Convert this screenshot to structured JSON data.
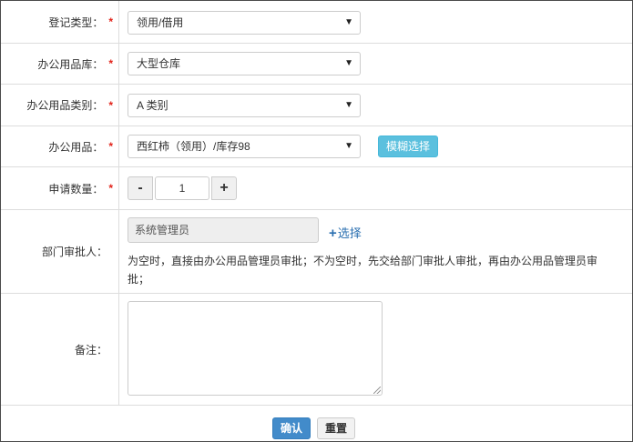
{
  "form": {
    "register_type": {
      "label": "登记类型：",
      "required_mark": "*",
      "value": "领用/借用"
    },
    "warehouse": {
      "label": "办公用品库：",
      "required_mark": "*",
      "value": "大型仓库"
    },
    "category": {
      "label": "办公用品类别：",
      "required_mark": "*",
      "value": "A 类别"
    },
    "item": {
      "label": "办公用品：",
      "required_mark": "*",
      "value": "西红柿（领用）/库存98",
      "fuzzy_button": "模糊选择"
    },
    "quantity": {
      "label": "申请数量：",
      "required_mark": "*",
      "value": "1",
      "minus": "-",
      "plus": "+"
    },
    "approver": {
      "label": "部门审批人：",
      "value": "系统管理员",
      "select_icon": "+",
      "select_link": "选择",
      "hint": "为空时，直接由办公用品管理员审批；不为空时，先交给部门审批人审批，再由办公用品管理员审批；"
    },
    "remark": {
      "label": "备注：",
      "value": ""
    }
  },
  "actions": {
    "confirm": "确认",
    "reset": "重置"
  },
  "icons": {
    "dropdown": "dropdown-caret-icon",
    "plus": "plus-icon"
  },
  "colors": {
    "required": "#e2231a",
    "info_button": "#5bc0de",
    "primary_button": "#428bca",
    "link": "#2a6fb0"
  }
}
